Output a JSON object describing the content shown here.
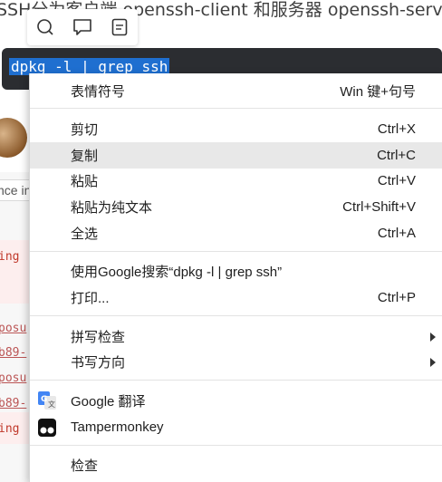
{
  "background": {
    "heading_text": "SSH分为客户端 openssh-client 和服务器 openssh-server",
    "code_command": "dpkg -l | grep ssh",
    "search_hint": "nce in",
    "fragments": [
      "ing",
      "posu",
      "b89-",
      "posu",
      "b89-",
      "ing '"
    ]
  },
  "toolbar": {
    "icons": [
      "search-icon",
      "comment-icon",
      "note-icon"
    ]
  },
  "context_menu": {
    "emoji": {
      "label": "表情符号",
      "shortcut": "Win 键+句号"
    },
    "cut": {
      "label": "剪切",
      "shortcut": "Ctrl+X"
    },
    "copy": {
      "label": "复制",
      "shortcut": "Ctrl+C"
    },
    "paste": {
      "label": "粘贴",
      "shortcut": "Ctrl+V"
    },
    "paste_plain": {
      "label": "粘贴为纯文本",
      "shortcut": "Ctrl+Shift+V"
    },
    "select_all": {
      "label": "全选",
      "shortcut": "Ctrl+A"
    },
    "google_search": {
      "label": "使用Google搜索“dpkg -l | grep ssh”"
    },
    "print": {
      "label": "打印...",
      "shortcut": "Ctrl+P"
    },
    "spellcheck": {
      "label": "拼写检查"
    },
    "writing_direction": {
      "label": "书写方向"
    },
    "google_translate": {
      "label": "Google 翻译"
    },
    "tampermonkey": {
      "label": "Tampermonkey"
    },
    "inspect": {
      "label": "检查"
    }
  },
  "colors": {
    "selection": "#1f6fd0",
    "highlight": "#e8e8e8",
    "code_bg": "#2b2d31"
  }
}
